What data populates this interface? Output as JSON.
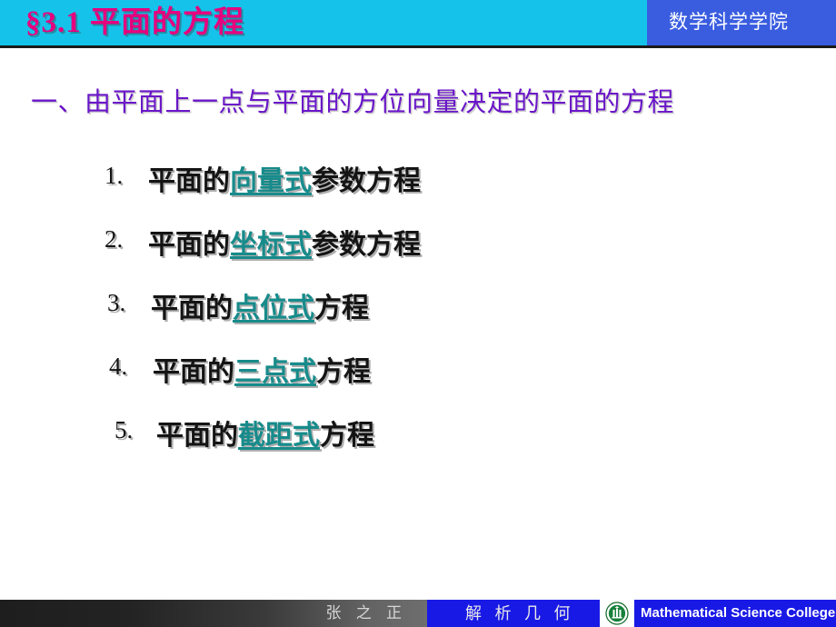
{
  "header": {
    "title": "§3.1  平面的方程",
    "org": "数学科学学院",
    "band_color": "#15c3ea",
    "right_band_color": "#3a5de0",
    "title_color": "#e6007e"
  },
  "subtitle": {
    "text": "一、由平面上一点与平面的方位向量决定的平面的方程",
    "color": "#6a16c8"
  },
  "list": {
    "keyword_color": "#178b8b",
    "items": [
      {
        "number": "1.",
        "prefix": "平面的",
        "keyword": "向量式",
        "suffix": "参数方程"
      },
      {
        "number": "2.",
        "prefix": "平面的",
        "keyword": "坐标式",
        "suffix": "参数方程"
      },
      {
        "number": "3.",
        "prefix": "平面的",
        "keyword": "点位式",
        "suffix": "方程"
      },
      {
        "number": "4.",
        "prefix": "平面的",
        "keyword": "三点式",
        "suffix": "方程"
      },
      {
        "number": "5.",
        "prefix": "平面的",
        "keyword": "截距式",
        "suffix": "方程"
      }
    ]
  },
  "footer": {
    "author": "张 之 正",
    "course": "解 析 几 何",
    "college": "Mathematical Science College",
    "logo_name": "university-seal-icon",
    "blue_color": "#1919e6",
    "logo_color": "#176b2e"
  }
}
